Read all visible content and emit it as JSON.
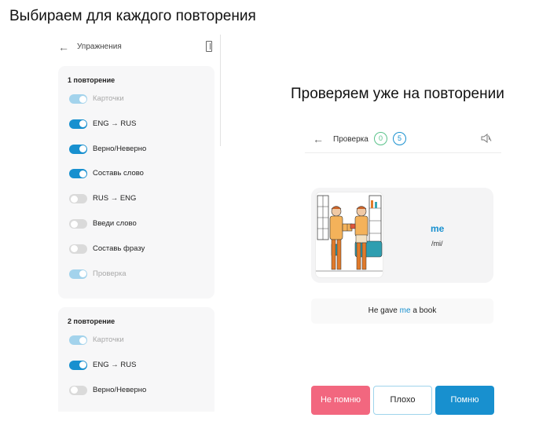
{
  "headings": {
    "left": "Выбираем для каждого повторения",
    "right": "Проверяем уже на повторении"
  },
  "settings_screen": {
    "title": "Упражнения",
    "icons": [
      "back-arrow-icon",
      "book-icon"
    ],
    "repetitions": [
      {
        "title": "1 повторение",
        "items": [
          {
            "label": "Карточки",
            "state": "on-locked"
          },
          {
            "label": "ENG → RUS",
            "state": "on"
          },
          {
            "label": "Верно/Неверно",
            "state": "on"
          },
          {
            "label": "Составь слово",
            "state": "on"
          },
          {
            "label": "RUS → ENG",
            "state": "off"
          },
          {
            "label": "Введи слово",
            "state": "off"
          },
          {
            "label": "Составь фразу",
            "state": "off"
          },
          {
            "label": "Проверка",
            "state": "on-locked"
          }
        ]
      },
      {
        "title": "2 повторение",
        "items": [
          {
            "label": "Карточки",
            "state": "on-locked"
          },
          {
            "label": "ENG → RUS",
            "state": "on"
          },
          {
            "label": "Верно/Неверно",
            "state": "off"
          }
        ]
      }
    ]
  },
  "check_screen": {
    "title": "Проверка",
    "correct_count": "0",
    "total_count": "5",
    "icons": [
      "back-arrow-icon",
      "speaker-muted-icon"
    ],
    "card": {
      "word": "me",
      "transcription": "/mi/",
      "image": "two-people-handing-book-illustration"
    },
    "example": {
      "before": "He gave ",
      "highlight": "me",
      "after": " a book"
    },
    "buttons": {
      "forgot": "Не помню",
      "bad": "Плохо",
      "remember": "Помню"
    },
    "colors": {
      "accent": "#1890cf",
      "forgot": "#f2677f",
      "correct": "#59c28a",
      "toggle_off": "#dadada",
      "toggle_locked": "#a3d3ec"
    }
  }
}
